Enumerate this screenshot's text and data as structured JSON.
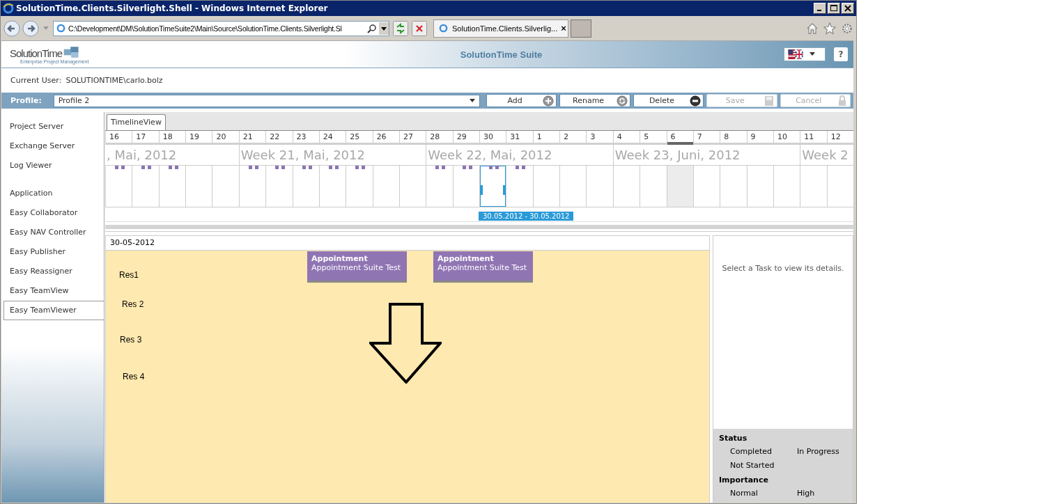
{
  "window": {
    "title": "SolutionTime.Clients.Silverlight.Shell - Windows Internet Explorer"
  },
  "browser": {
    "address": "C:\\Development\\DM\\SolutionTimeSuite2\\Main\\Source\\SolutionTime.Clients.Silverlight.Sl",
    "tab": {
      "label": "SolutionTime.Clients.Silverlig...",
      "close": "×"
    }
  },
  "header": {
    "logo": "SolutionTime",
    "logo_tagline": "Enterprise Project Management",
    "title": "SolutionTime Suite",
    "help": "?"
  },
  "current_user": {
    "label": "Current User:",
    "value": "SOLUTIONTIME\\carlo.bolz"
  },
  "profile": {
    "label": "Profile:",
    "value": "Profile 2",
    "buttons": [
      {
        "label": "Add",
        "kind": "add",
        "disabled": false
      },
      {
        "label": "Rename",
        "kind": "rename",
        "disabled": false
      },
      {
        "label": "Delete",
        "kind": "delete",
        "disabled": false
      },
      {
        "label": "Save",
        "kind": "save",
        "disabled": true
      },
      {
        "label": "Cancel",
        "kind": "cancel",
        "disabled": true
      }
    ]
  },
  "sidebar": {
    "groups": [
      {
        "items": [
          {
            "label": "Project Server",
            "selected": false
          },
          {
            "label": "Exchange Server",
            "selected": false
          },
          {
            "label": "Log Viewer",
            "selected": false
          }
        ]
      },
      {
        "items": [
          {
            "label": "Application",
            "selected": false
          },
          {
            "label": "Easy Collaborator",
            "selected": false
          },
          {
            "label": "Easy NAV Controller",
            "selected": false
          },
          {
            "label": "Easy Publisher",
            "selected": false
          },
          {
            "label": "Easy Reassigner",
            "selected": false
          },
          {
            "label": "Easy TeamView",
            "selected": false
          },
          {
            "label": "Easy TeamViewer",
            "selected": true
          }
        ]
      }
    ]
  },
  "tabs": [
    {
      "label": "TimelineView",
      "selected": true
    }
  ],
  "timeline": {
    "range": "30.05.2012 - 30.05.2012",
    "weeks": [
      {
        "label": ", Mai, 2012",
        "days": [
          {
            "label": "16",
            "events": true,
            "selected": false,
            "today": false
          },
          {
            "label": "17",
            "events": true,
            "selected": false,
            "today": false
          },
          {
            "label": "18",
            "events": true,
            "selected": false,
            "today": false
          },
          {
            "label": "19",
            "events": false,
            "selected": false,
            "today": false
          },
          {
            "label": "20",
            "events": false,
            "selected": false,
            "today": false
          }
        ]
      },
      {
        "label": "Week 21, Mai, 2012",
        "days": [
          {
            "label": "21",
            "events": true,
            "selected": false,
            "today": false
          },
          {
            "label": "22",
            "events": true,
            "selected": false,
            "today": false
          },
          {
            "label": "23",
            "events": true,
            "selected": false,
            "today": false
          },
          {
            "label": "24",
            "events": true,
            "selected": false,
            "today": false
          },
          {
            "label": "25",
            "events": true,
            "selected": false,
            "today": false
          },
          {
            "label": "26",
            "events": false,
            "selected": false,
            "today": false
          },
          {
            "label": "27",
            "events": false,
            "selected": false,
            "today": false
          }
        ]
      },
      {
        "label": "Week 22, Mai, 2012",
        "days": [
          {
            "label": "28",
            "events": true,
            "selected": false,
            "today": false
          },
          {
            "label": "29",
            "events": true,
            "selected": false,
            "today": false
          },
          {
            "label": "30",
            "events": true,
            "selected": true,
            "today": false
          },
          {
            "label": "31",
            "events": true,
            "selected": false,
            "today": false
          },
          {
            "label": "1",
            "events": false,
            "selected": false,
            "today": false
          },
          {
            "label": "2",
            "events": false,
            "selected": false,
            "today": false
          },
          {
            "label": "3",
            "events": false,
            "selected": false,
            "today": false
          }
        ]
      },
      {
        "label": "Week 23, Juni, 2012",
        "days": [
          {
            "label": "4",
            "events": false,
            "selected": false,
            "today": false
          },
          {
            "label": "5",
            "events": false,
            "selected": false,
            "today": false
          },
          {
            "label": "6",
            "events": false,
            "selected": false,
            "today": true
          },
          {
            "label": "7",
            "events": false,
            "selected": false,
            "today": false
          },
          {
            "label": "8",
            "events": false,
            "selected": false,
            "today": false
          },
          {
            "label": "9",
            "events": false,
            "selected": false,
            "today": false
          },
          {
            "label": "10",
            "events": false,
            "selected": false,
            "today": false
          }
        ]
      },
      {
        "label": "Week 2",
        "days": [
          {
            "label": "11",
            "events": false,
            "selected": false,
            "today": false
          },
          {
            "label": "12",
            "events": false,
            "selected": false,
            "today": false
          }
        ]
      }
    ]
  },
  "schedule": {
    "date": "30-05-2012",
    "resources": [
      "Res1",
      "Res 2",
      "Res 3",
      "Res 4"
    ],
    "appointments": [
      {
        "title": "Appointment",
        "subtitle": "Appointment Suite Test"
      },
      {
        "title": "Appointment",
        "subtitle": "Appointment Suite Test"
      }
    ]
  },
  "details": {
    "message": "Select a Task to view its details.",
    "legend": [
      {
        "title": "Status",
        "items": [
          "Completed",
          "In Progress",
          "Not Started"
        ]
      },
      {
        "title": "Importance",
        "items": [
          "Normal",
          "High"
        ]
      }
    ]
  }
}
